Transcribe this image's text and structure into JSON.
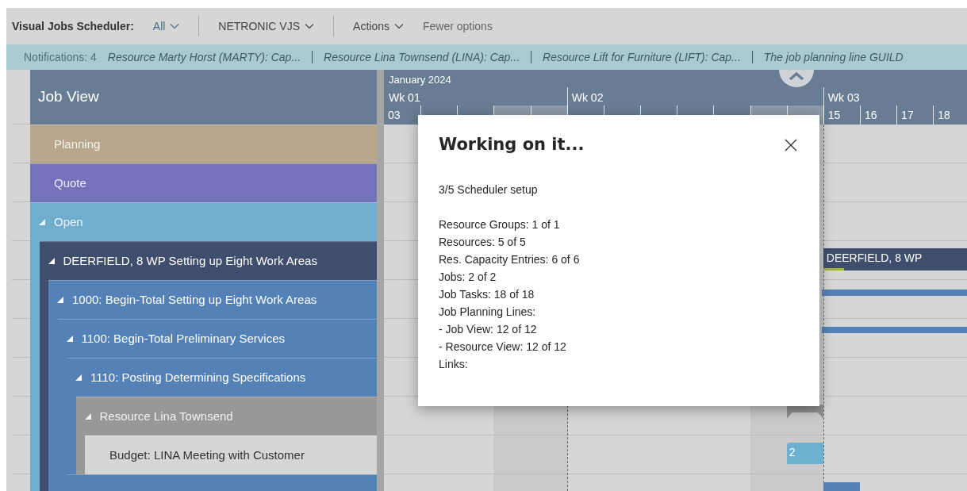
{
  "toolbar": {
    "title": "Visual Jobs Scheduler:",
    "items": [
      {
        "kind": "filter",
        "label": "All"
      },
      {
        "kind": "dropdown",
        "label": "NETRONIC VJS"
      },
      {
        "kind": "dropdown",
        "label": "Actions"
      },
      {
        "kind": "link",
        "label": "Fewer options"
      }
    ]
  },
  "notifications": {
    "count": "Notifications: 4",
    "messages": [
      "Resource Marty Horst (MARTY): Cap...",
      "Resource Lina Townsend (LINA): Cap...",
      "Resource Lift for Furniture (LIFT): Cap...",
      "The job planning line GUILD"
    ]
  },
  "tree": {
    "title": "Job View",
    "rows": [
      {
        "kind": "status",
        "label": "Planning",
        "color": "#b8a78c",
        "expanded": false
      },
      {
        "kind": "status",
        "label": "Quote",
        "color": "#7472bb",
        "expanded": false
      },
      {
        "kind": "status",
        "label": "Open",
        "color": "#71aecd",
        "expanded": true,
        "children": [
          {
            "kind": "job",
            "label": "DEERFIELD, 8 WP Setting up Eight Work Areas",
            "color": "#3f4e6c",
            "expanded": true,
            "children": [
              {
                "kind": "task",
                "label": "1000: Begin-Total Setting up Eight Work Areas",
                "color": "#5582b6",
                "expanded": true,
                "children": [
                  {
                    "kind": "task",
                    "label": "1100: Begin-Total Preliminary Services",
                    "color": "#5582b6",
                    "expanded": true,
                    "children": [
                      {
                        "kind": "task",
                        "label": "1110: Posting Determining Specifications",
                        "color": "#5582b6",
                        "expanded": true,
                        "children": [
                          {
                            "kind": "resource",
                            "label": "Resource Lina Townsend",
                            "color": "#989898",
                            "expanded": true,
                            "children": [
                              {
                                "kind": "line",
                                "label": "Budget: LINA Meeting with Customer",
                                "color": "#d6d6d6",
                                "expanded": false
                              }
                            ]
                          }
                        ]
                      },
                      {
                        "kind": "task",
                        "color": "#5582b6"
                      }
                    ]
                  }
                ]
              }
            ]
          }
        ]
      }
    ]
  },
  "timeline": {
    "month": "January 2024",
    "weeks": [
      "Wk 01",
      "Wk 02",
      "Wk 03"
    ],
    "days": [
      {
        "label": "03",
        "weekend": false
      },
      {
        "weekend": false
      },
      {
        "weekend": false
      },
      {
        "weekend": true
      },
      {
        "weekend": true
      },
      {
        "weekend": false
      },
      {
        "weekend": false
      },
      {
        "weekend": false
      },
      {
        "weekend": false
      },
      {
        "weekend": false
      },
      {
        "weekend": true
      },
      {
        "weekend": true
      },
      {
        "label": "15",
        "weekend": false
      },
      {
        "label": "16",
        "weekend": false
      },
      {
        "label": "17",
        "weekend": false
      },
      {
        "label": "18",
        "weekend": false
      }
    ],
    "bars": [
      {
        "kind": "summary",
        "label": "DEERFIELD, 8 WP"
      },
      {
        "kind": "thin"
      },
      {
        "kind": "thin"
      },
      {
        "kind": "resource"
      },
      {
        "kind": "task",
        "label": "2"
      },
      {
        "kind": "task"
      }
    ]
  },
  "dialog": {
    "title": "Working on it...",
    "step": "3/5 Scheduler setup",
    "lines": [
      "Resource Groups: 1 of 1",
      "Resources: 5 of 5",
      "Res. Capacity Entries: 6 of 6",
      "Jobs: 2 of 2",
      "Job Tasks: 18 of 18",
      "Job Planning Lines:",
      "- Job View: 12 of 12",
      "- Resource View: 12 of 12",
      "Links:"
    ]
  }
}
